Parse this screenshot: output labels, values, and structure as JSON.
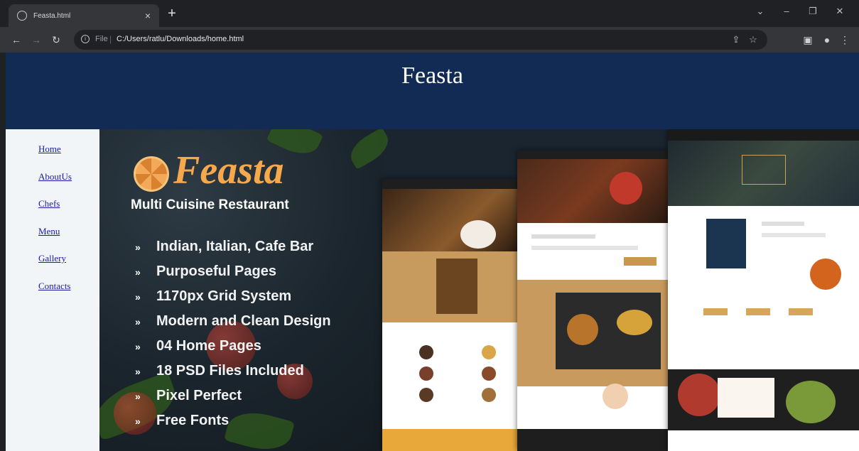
{
  "browser": {
    "tab_title": "Feasta.html",
    "tab_close": "×",
    "new_tab": "+",
    "url_scheme": "File",
    "url_separator": "|",
    "url": "C:/Users/ratlu/Downloads/home.html",
    "window_controls": {
      "dropdown": "⌄",
      "minimize": "–",
      "restore": "❐",
      "close": "✕"
    }
  },
  "page": {
    "site_title": "Feasta",
    "nav": [
      "Home",
      "AboutUs",
      "Chefs",
      "Menu",
      "Gallery",
      "Contacts"
    ],
    "banner": {
      "brand": "Feasta",
      "tagline": "Multi Cuisine Restaurant",
      "bullet_glyph": "»",
      "features": [
        "Indian, Italian, Cafe Bar",
        "Purposeful Pages",
        "1170px Grid System",
        "Modern and Clean Design",
        "04 Home Pages",
        "18 PSD Files Included",
        "Pixel Perfect",
        "Free Fonts"
      ]
    }
  },
  "colors": {
    "header_bg": "#112b54",
    "nav_bg": "#f1f5f7",
    "link": "#1a1aaa",
    "brand_orange": "#f5a94c"
  }
}
